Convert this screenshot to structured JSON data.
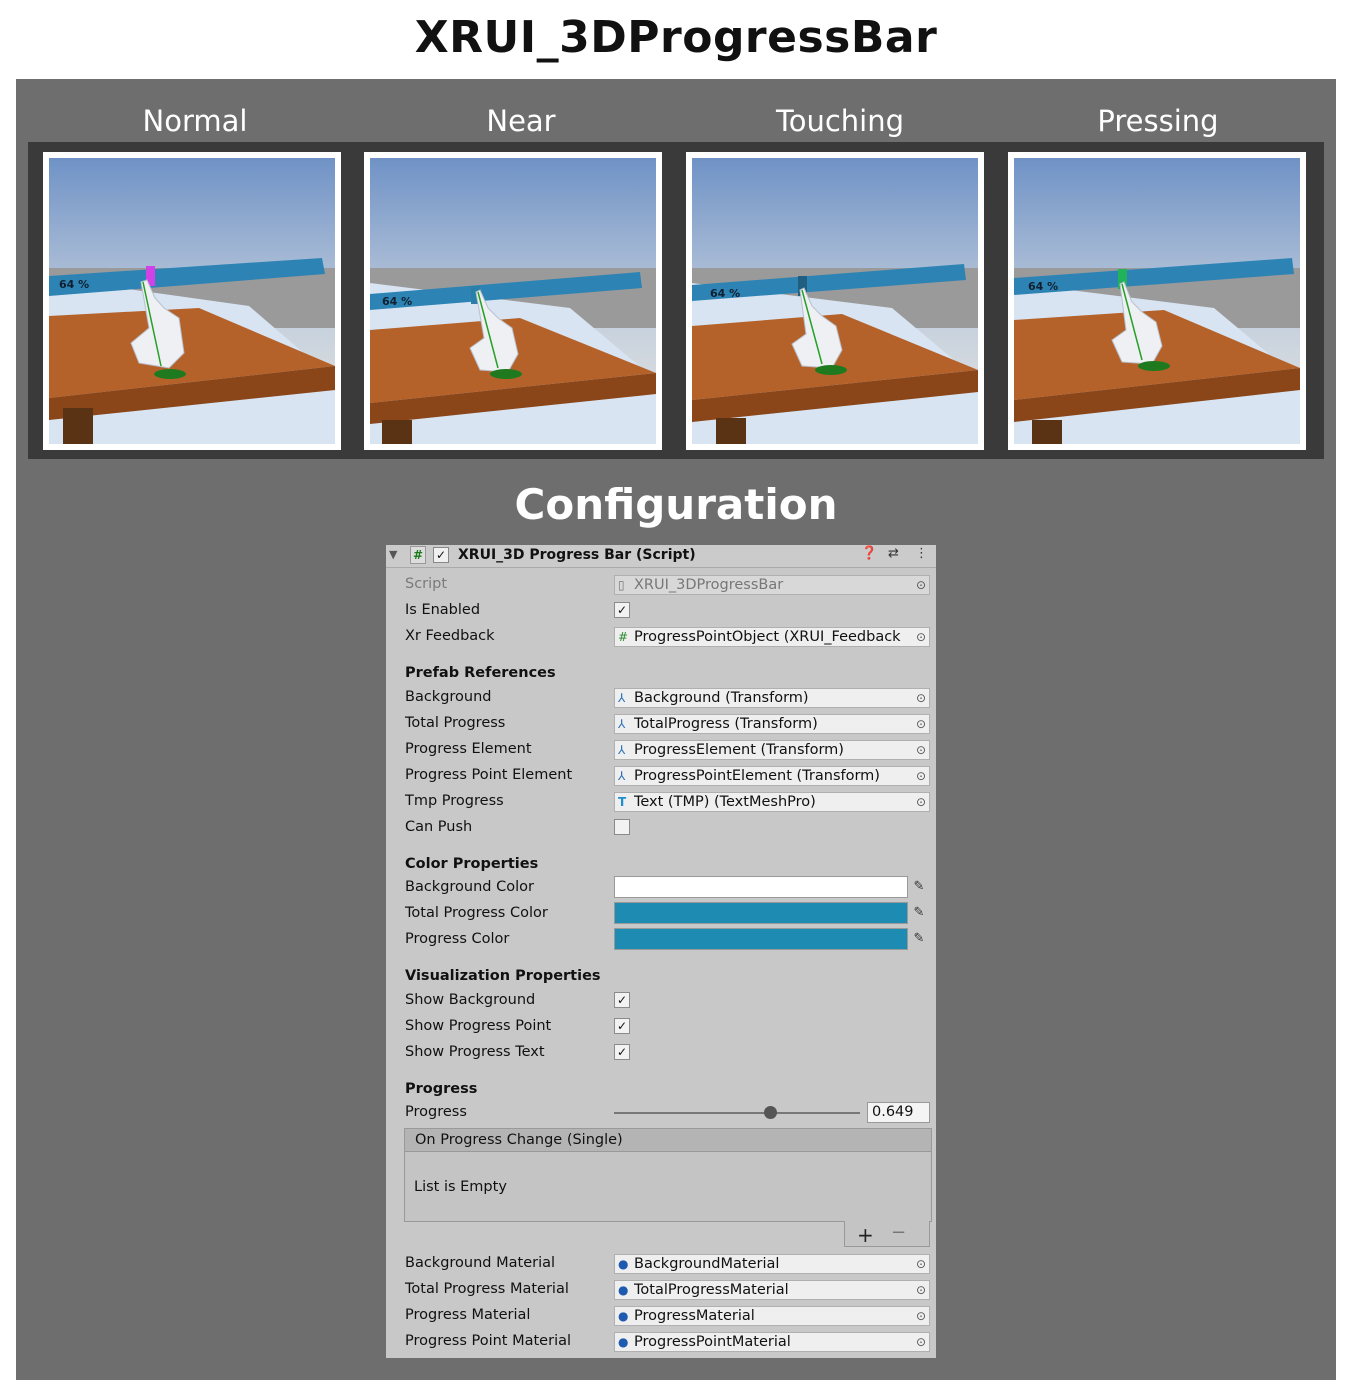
{
  "title": "XRUI_3DProgressBar",
  "states": [
    "Normal",
    "Near",
    "Touching",
    "Pressing"
  ],
  "progress_text": "64 %",
  "progress_point_colors": {
    "normal": "#d041e8",
    "near": "#2a7fa8",
    "touching": "#215f80",
    "pressing": "#21b35a"
  },
  "colors": {
    "stage_bg": "#6e6e6e",
    "bar_color": "#2d84b4",
    "table_color": "#b5622a"
  },
  "config_title": "Configuration",
  "inspector": {
    "header_title": "XRUI_3D Progress Bar (Script)",
    "script_label": "Script",
    "script_value": "XRUI_3DProgressBar",
    "is_enabled_label": "Is Enabled",
    "xr_feedback_label": "Xr Feedback",
    "xr_feedback_value": "ProgressPointObject (XRUI_Feedback",
    "prefab_section": "Prefab References",
    "background_label": "Background",
    "background_value": "Background (Transform)",
    "total_progress_label": "Total Progress",
    "total_progress_value": "TotalProgress (Transform)",
    "progress_element_label": "Progress Element",
    "progress_element_value": "ProgressElement (Transform)",
    "progress_point_element_label": "Progress Point Element",
    "progress_point_element_value": "ProgressPointElement (Transform)",
    "tmp_progress_label": "Tmp Progress",
    "tmp_progress_value": "Text (TMP) (TextMeshPro)",
    "can_push_label": "Can Push",
    "color_section": "Color Properties",
    "background_color_label": "Background Color",
    "background_color_value": "#ffffff",
    "total_progress_color_label": "Total Progress Color",
    "total_progress_color_value": "#1d8bb2",
    "progress_color_label": "Progress Color",
    "progress_color_value": "#1d8bb2",
    "visualization_section": "Visualization Properties",
    "show_background_label": "Show Background",
    "show_progress_point_label": "Show Progress Point",
    "show_progress_text_label": "Show Progress Text",
    "progress_section": "Progress",
    "progress_label": "Progress",
    "progress_value": "0.649",
    "event_header": "On Progress Change (Single)",
    "event_empty": "List is Empty",
    "background_material_label": "Background Material",
    "background_material_value": "BackgroundMaterial",
    "total_progress_material_label": "Total Progress Material",
    "total_progress_material_value": "TotalProgressMaterial",
    "progress_material_label": "Progress Material",
    "progress_material_value": "ProgressMaterial",
    "progress_point_material_label": "Progress Point Material",
    "progress_point_material_value": "ProgressPointMaterial"
  }
}
